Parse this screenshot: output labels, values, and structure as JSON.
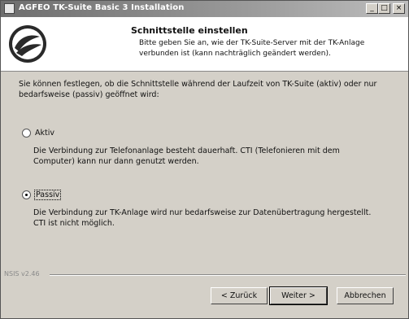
{
  "window": {
    "title": "AGFEO TK-Suite Basic 3 Installation"
  },
  "header": {
    "title": "Schnittstelle einstellen",
    "subtitle": "Bitte geben Sie an, wie der TK-Suite-Server mit der TK-Anlage verbunden ist (kann nachträglich geändert werden)."
  },
  "main": {
    "intro": "Sie können festlegen, ob die Schnittstelle während der Laufzeit von TK-Suite (aktiv) oder nur bedarfsweise (passiv) geöffnet wird:",
    "options": [
      {
        "label": "Aktiv",
        "checked": false,
        "description": "Die Verbindung zur Telefonanlage besteht dauerhaft. CTI (Telefonieren mit dem Computer) kann nur dann genutzt werden."
      },
      {
        "label": "Passiv",
        "checked": true,
        "description": "Die Verbindung zur TK-Anlage wird nur bedarfsweise zur Datenübertragung hergestellt. CTI ist nicht möglich."
      }
    ]
  },
  "footer": {
    "brand": "NSIS v2.46",
    "back_label": "< Zurück",
    "next_label": "Weiter >",
    "cancel_label": "Abbrechen"
  }
}
